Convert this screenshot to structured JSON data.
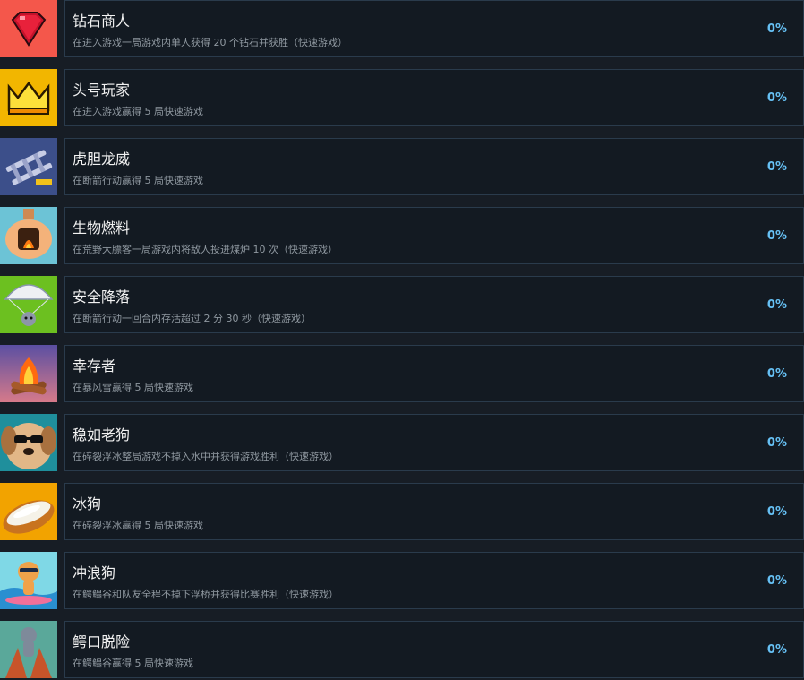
{
  "achievements": [
    {
      "title": "钻石商人",
      "desc": "在进入游戏一局游戏内单人获得 20 个钻石并获胜（快速游戏）",
      "percent": "0%",
      "icon": "diamond-icon",
      "bg": "#f4574b"
    },
    {
      "title": "头号玩家",
      "desc": "在进入游戏赢得 5 局快速游戏",
      "percent": "0%",
      "icon": "crown-icon",
      "bg": "#f2b600"
    },
    {
      "title": "虎胆龙威",
      "desc": "在断箭行动赢得 5 局快速游戏",
      "percent": "0%",
      "icon": "ladder-icon",
      "bg": "#3c4f8a"
    },
    {
      "title": "生物燃料",
      "desc": "在荒野大膘客一局游戏内将敌人投进煤炉 10 次（快速游戏）",
      "percent": "0%",
      "icon": "furnace-icon",
      "bg": "#6cc3d6"
    },
    {
      "title": "安全降落",
      "desc": "在断箭行动一回合内存活超过 2 分 30 秒（快速游戏）",
      "percent": "0%",
      "icon": "parachute-icon",
      "bg": "#6cc020"
    },
    {
      "title": "幸存者",
      "desc": "在暴风雪赢得 5 局快速游戏",
      "percent": "0%",
      "icon": "campfire-icon",
      "bg": "#5b4fa2"
    },
    {
      "title": "稳如老狗",
      "desc": "在碎裂浮冰整局游戏不掉入水中并获得游戏胜利（快速游戏）",
      "percent": "0%",
      "icon": "dog-sunglasses-icon",
      "bg": "#1f8f9c"
    },
    {
      "title": "冰狗",
      "desc": "在碎裂浮冰赢得 5 局快速游戏",
      "percent": "0%",
      "icon": "hotdog-icon",
      "bg": "#f2a300"
    },
    {
      "title": "冲浪狗",
      "desc": "在鳄鳎谷和队友全程不掉下浮桥并获得比赛胜利（快速游戏）",
      "percent": "0%",
      "icon": "surf-dog-icon",
      "bg": "#7fd8e6"
    },
    {
      "title": "鳄口脱险",
      "desc": "在鳄鳎谷赢得 5 局快速游戏",
      "percent": "0%",
      "icon": "cat-crocodile-icon",
      "bg": "#5aa89a"
    }
  ]
}
